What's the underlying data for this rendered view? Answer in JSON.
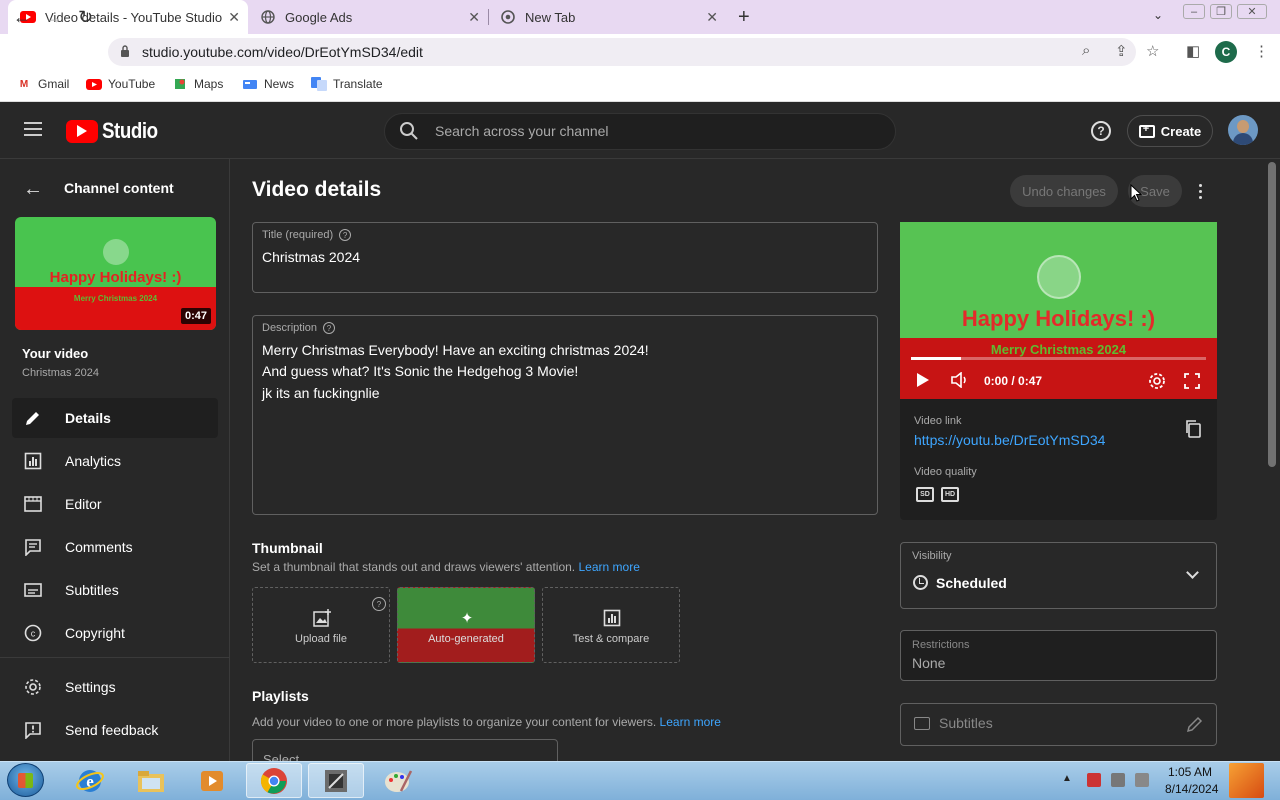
{
  "browser": {
    "tabs": [
      {
        "title": "Video details - YouTube Studio",
        "active": true
      },
      {
        "title": "Google Ads",
        "active": false
      },
      {
        "title": "New Tab",
        "active": false
      }
    ],
    "url": "studio.youtube.com/video/DrEotYmSD34/edit",
    "profile_initial": "C",
    "bookmarks": [
      "Gmail",
      "YouTube",
      "Maps",
      "News",
      "Translate"
    ]
  },
  "studio": {
    "logo_text": "Studio",
    "search_placeholder": "Search across your channel",
    "create_label": "Create"
  },
  "sidebar": {
    "back_label": "Channel content",
    "thumb": {
      "headline": "Happy Holidays! :)",
      "subline": "Merry Christmas 2024",
      "duration": "0:47"
    },
    "your_video_label": "Your video",
    "video_title": "Christmas 2024",
    "nav": [
      {
        "label": "Details",
        "icon": "pencil-icon",
        "active": true
      },
      {
        "label": "Analytics",
        "icon": "analytics-icon",
        "active": false
      },
      {
        "label": "Editor",
        "icon": "film-icon",
        "active": false
      },
      {
        "label": "Comments",
        "icon": "comment-icon",
        "active": false
      },
      {
        "label": "Subtitles",
        "icon": "subtitles-icon",
        "active": false
      },
      {
        "label": "Copyright",
        "icon": "copyright-icon",
        "active": false
      },
      {
        "label": "Settings",
        "icon": "gear-icon",
        "active": false
      },
      {
        "label": "Send feedback",
        "icon": "feedback-icon",
        "active": false
      }
    ]
  },
  "main": {
    "page_title": "Video details",
    "undo_label": "Undo changes",
    "save_label": "Save",
    "title_field": {
      "label": "Title (required)",
      "value": "Christmas 2024"
    },
    "description_field": {
      "label": "Description",
      "lines": [
        "Merry Christmas Everybody! Have an exciting christmas 2024!",
        "And guess what? It's Sonic the Hedgehog 3 Movie!",
        "jk its an fuckingnlie"
      ]
    },
    "thumbnail": {
      "title": "Thumbnail",
      "subtitle": "Set a thumbnail that stands out and draws viewers' attention.",
      "learn_more": "Learn more",
      "options": [
        "Upload file",
        "Auto-generated",
        "Test & compare"
      ]
    },
    "playlists": {
      "title": "Playlists",
      "subtitle": "Add your video to one or more playlists to organize your content for viewers.",
      "learn_more": "Learn more",
      "select_placeholder": "Select"
    }
  },
  "right": {
    "player": {
      "headline": "Happy Holidays! :)",
      "subline": "Merry Christmas 2024",
      "time": "0:00 / 0:47",
      "progress": 0.17
    },
    "video_link_label": "Video link",
    "video_link": "https://youtu.be/DrEotYmSD34",
    "video_quality_label": "Video quality",
    "quality_badges": [
      "SD",
      "HD"
    ],
    "visibility_label": "Visibility",
    "visibility_value": "Scheduled",
    "restrictions_label": "Restrictions",
    "restrictions_value": "None",
    "subtitles_label": "Subtitles"
  },
  "taskbar": {
    "time": "1:05 AM",
    "date": "8/14/2024"
  },
  "colors": {
    "accent_link": "#3ea6ff",
    "youtube_red": "#ff0000",
    "background": "#282828"
  }
}
